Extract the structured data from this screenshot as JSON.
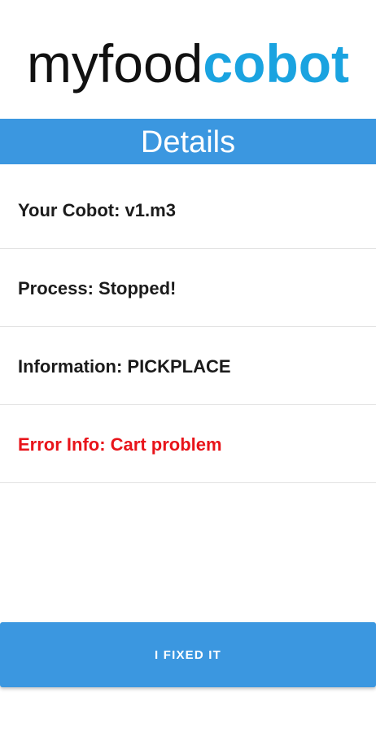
{
  "logo": {
    "part_light": "myfood",
    "part_bold": "cobot"
  },
  "header": {
    "title": "Details"
  },
  "details": {
    "cobot": "Your Cobot: v1.m3",
    "process": "Process: Stopped!",
    "information": "Information: PICKPLACE",
    "error": "Error Info: Cart problem"
  },
  "actions": {
    "fixed_label": "I FIXED IT"
  },
  "colors": {
    "accent_blue": "#3b97e0",
    "logo_blue": "#1aa3e0",
    "error_red": "#e8141a"
  }
}
